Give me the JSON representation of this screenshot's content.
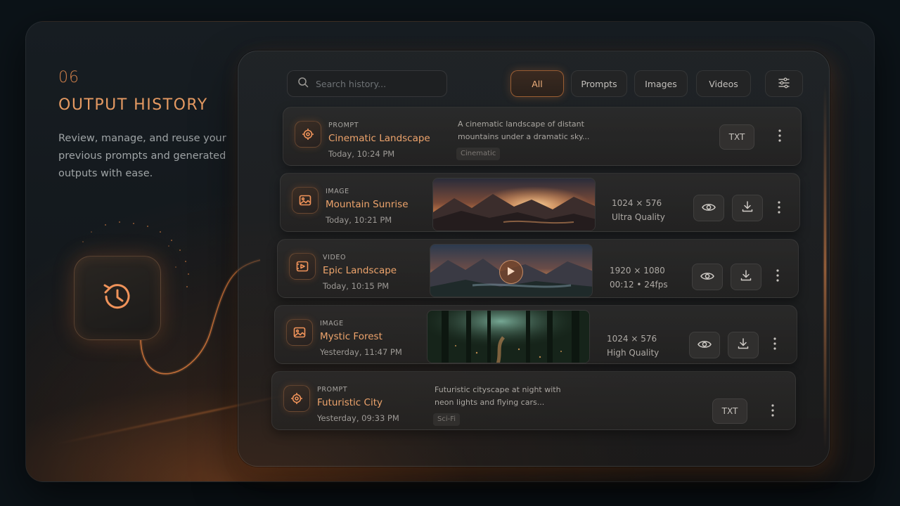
{
  "section": {
    "number": "06",
    "title": "OUTPUT HISTORY",
    "description": "Review, manage, and reuse your previous prompts and generated outputs with ease."
  },
  "toolbar": {
    "search_placeholder": "Search history...",
    "filters": [
      "All",
      "Prompts",
      "Images",
      "Videos"
    ],
    "active_filter": "All",
    "settings_icon": "sliders-icon"
  },
  "items": [
    {
      "kind": "prompt",
      "type_label": "PROMPT",
      "title": "Cinematic Landscape",
      "time": "Today, 10:24 PM",
      "text": "A cinematic landscape of distant mountains under a dramatic sky...",
      "tag": "Cinematic",
      "action": "TXT"
    },
    {
      "kind": "image",
      "type_label": "IMAGE",
      "title": "Mountain Sunrise",
      "time": "Today, 10:21 PM",
      "meta1": "1024 × 576",
      "meta2": "Ultra Quality"
    },
    {
      "kind": "video",
      "type_label": "VIDEO",
      "title": "Epic Landscape",
      "time": "Today, 10:15 PM",
      "meta1": "1920 × 1080",
      "meta2": "00:12 • 24fps"
    },
    {
      "kind": "image",
      "type_label": "IMAGE",
      "title": "Mystic Forest",
      "time": "Yesterday, 11:47 PM",
      "meta1": "1024 × 576",
      "meta2": "High Quality"
    },
    {
      "kind": "prompt",
      "type_label": "PROMPT",
      "title": "Futuristic City",
      "time": "Yesterday, 09:33 PM",
      "text": "Futuristic cityscape at night with neon lights and flying cars...",
      "tag": "Sci-Fi",
      "action": "TXT"
    }
  ],
  "colors": {
    "accent": "#e8955c",
    "background": "#0c1318",
    "panel": "#2a2928"
  }
}
